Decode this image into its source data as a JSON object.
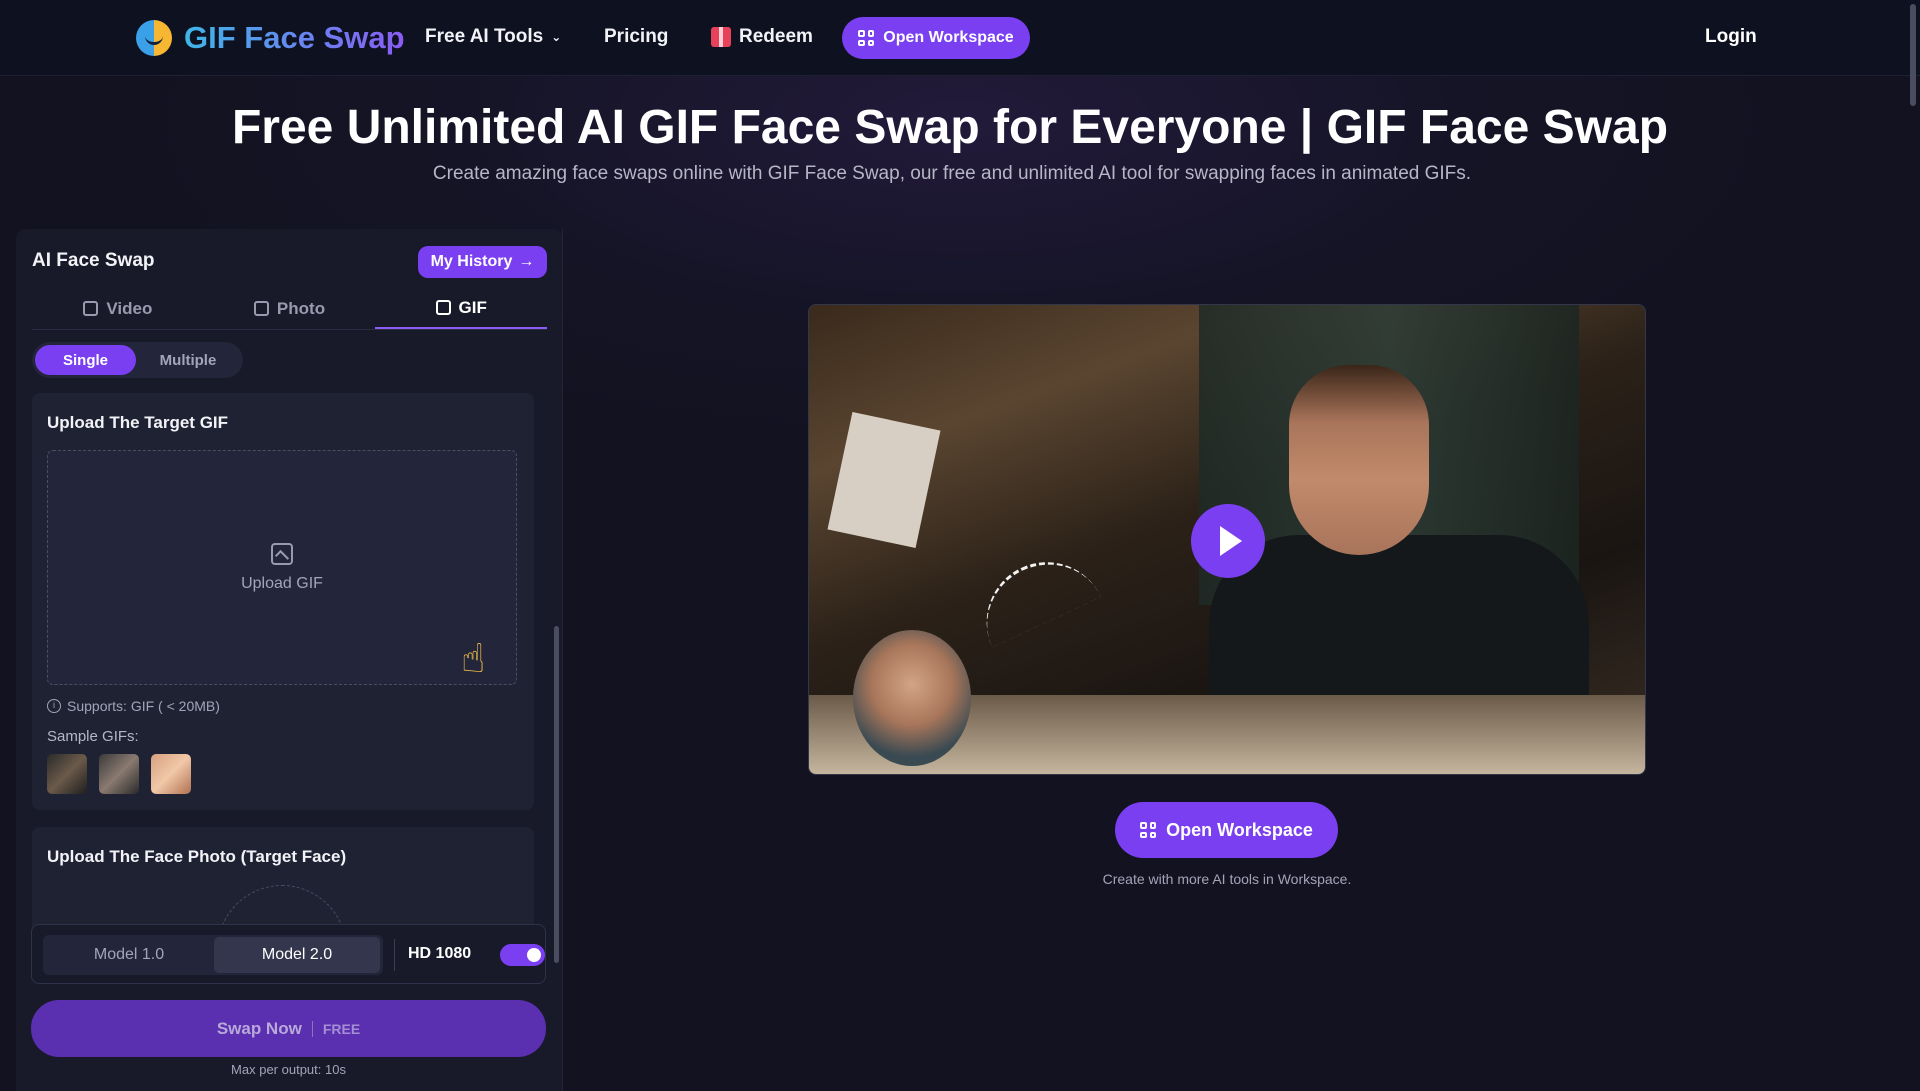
{
  "nav": {
    "logo_text": "GIF Face Swap",
    "free_tools": "Free AI Tools",
    "pricing": "Pricing",
    "redeem": "Redeem",
    "open_workspace": "Open Workspace",
    "login": "Login"
  },
  "hero": {
    "title": "Free Unlimited AI GIF Face Swap for Everyone | GIF Face Swap",
    "subtitle": "Create amazing face swaps online with GIF Face Swap, our free and unlimited AI tool for swapping faces in animated GIFs."
  },
  "panel": {
    "title": "AI Face Swap",
    "history_button": "My History",
    "tabs": [
      {
        "label": "Video",
        "active": false
      },
      {
        "label": "Photo",
        "active": false
      },
      {
        "label": "GIF",
        "active": true
      }
    ],
    "mode": {
      "single": "Single",
      "multiple": "Multiple",
      "selected": "Single"
    },
    "target_card": {
      "title": "Upload The Target GIF",
      "drop_label": "Upload GIF",
      "supports": "Supports: GIF ( < 20MB)",
      "samples_label": "Sample GIFs:"
    },
    "face_card": {
      "title": "Upload The Face Photo (Target Face)"
    },
    "models": {
      "model1": "Model 1.0",
      "model2": "Model 2.0",
      "selected": "Model 2.0"
    },
    "hd": {
      "label": "HD 1080",
      "enabled": true
    },
    "swap": {
      "label": "Swap Now",
      "badge": "FREE"
    },
    "max_note": "Max per output: 10s"
  },
  "preview": {
    "workspace_button": "Open Workspace",
    "note": "Create with more AI tools in Workspace."
  },
  "colors": {
    "accent": "#7a3ff0",
    "background": "#131322",
    "nav": "#0e1120",
    "card": "#1f2233"
  }
}
